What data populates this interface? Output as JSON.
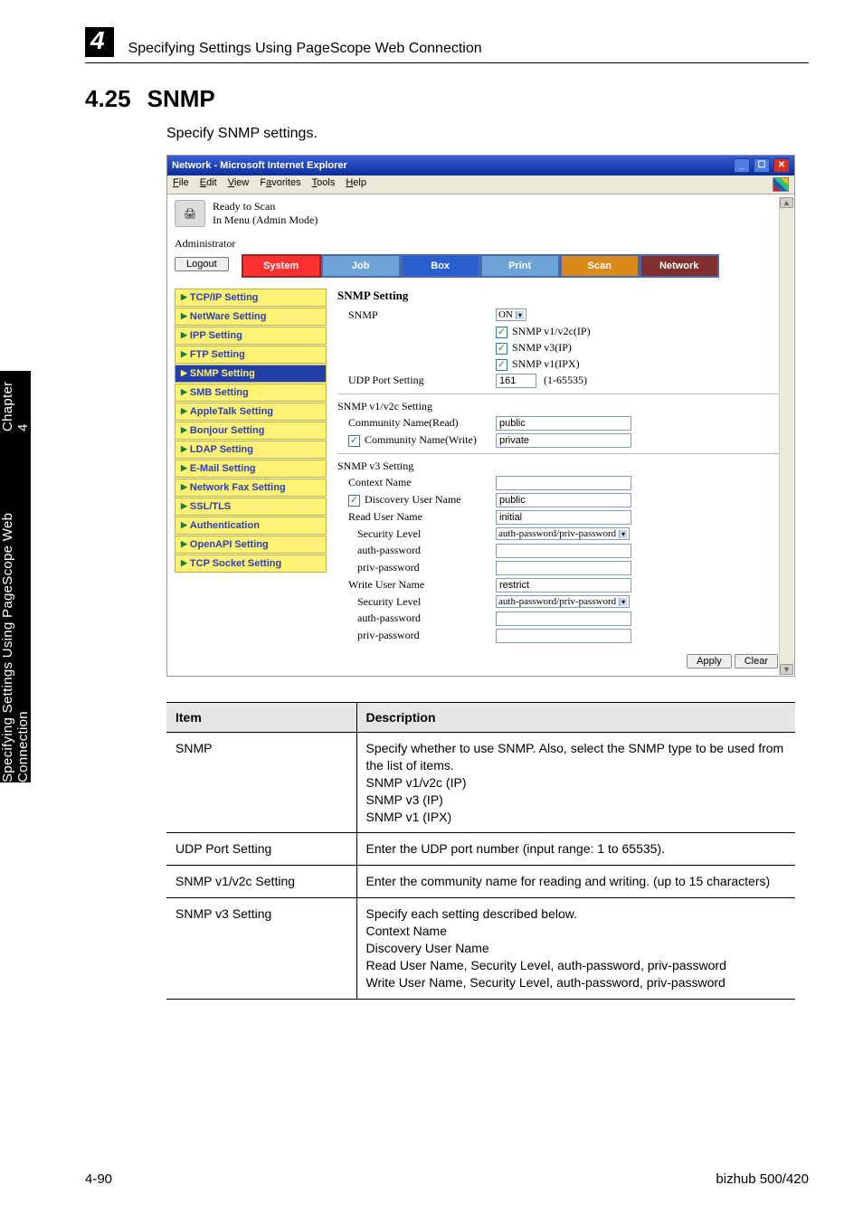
{
  "header": {
    "chapter_number": "4",
    "running_title": "Specifying Settings Using PageScope Web Connection"
  },
  "side_tab": {
    "line1": "Specifying Settings Using PageScope Web Connection",
    "chapter": "Chapter 4"
  },
  "section": {
    "number": "4.25",
    "title": "SNMP",
    "description": "Specify SNMP settings."
  },
  "window": {
    "title": "Network - Microsoft Internet Explorer",
    "menus": [
      "File",
      "Edit",
      "View",
      "Favorites",
      "Tools",
      "Help"
    ],
    "device_status1": "Ready to Scan",
    "device_status2": "In Menu (Admin Mode)",
    "admin_label": "Administrator",
    "logout": "Logout",
    "tabs": {
      "system": "System",
      "job": "Job",
      "box": "Box",
      "print": "Print",
      "scan": "Scan",
      "network": "Network"
    },
    "sidebar": [
      "TCP/IP Setting",
      "NetWare Setting",
      "IPP Setting",
      "FTP Setting",
      "SNMP Setting",
      "SMB Setting",
      "AppleTalk Setting",
      "Bonjour Setting",
      "LDAP Setting",
      "E-Mail Setting",
      "Network Fax Setting",
      "SSL/TLS",
      "Authentication",
      "OpenAPI Setting",
      "TCP Socket Setting"
    ],
    "content": {
      "heading": "SNMP Setting",
      "snmp_label": "SNMP",
      "snmp_value": "ON",
      "snmp_opts": [
        "SNMP v1/v2c(IP)",
        "SNMP v3(IP)",
        "SNMP v1(IPX)"
      ],
      "udp_label": "UDP Port Setting",
      "udp_value": "161",
      "udp_range": "(1-65535)",
      "v12_head": "SNMP v1/v2c Setting",
      "comm_read_label": "Community Name(Read)",
      "comm_read_value": "public",
      "comm_write_chk_label": "Community Name(Write)",
      "comm_write_value": "private",
      "v3_head": "SNMP v3 Setting",
      "ctx_label": "Context Name",
      "disc_chk_label": "Discovery User Name",
      "disc_value": "public",
      "read_user_label": "Read User Name",
      "read_user_value": "initial",
      "sec_level_label": "Security Level",
      "sec_level_value": "auth-password/priv-password",
      "auth_pw_label": "auth-password",
      "priv_pw_label": "priv-password",
      "write_user_label": "Write User Name",
      "write_user_value": "restrict",
      "apply": "Apply",
      "clear": "Clear"
    }
  },
  "table": {
    "col_item": "Item",
    "col_desc": "Description",
    "rows": [
      {
        "item": "SNMP",
        "desc": "Specify whether to use SNMP. Also, select the SNMP type to be used from the list of items.\nSNMP v1/v2c (IP)\nSNMP v3 (IP)\nSNMP v1 (IPX)"
      },
      {
        "item": "UDP Port Setting",
        "desc": "Enter the UDP port number (input range: 1 to 65535)."
      },
      {
        "item": "SNMP v1/v2c Setting",
        "desc": "Enter the community name for reading and writing. (up to 15 characters)"
      },
      {
        "item": "SNMP v3 Setting",
        "desc": "Specify each setting described below.\nContext Name\nDiscovery User Name\nRead User Name, Security Level, auth-password, priv-password\nWrite User Name, Security Level, auth-password, priv-password"
      }
    ]
  },
  "footer": {
    "page": "4-90",
    "product": "bizhub 500/420"
  }
}
